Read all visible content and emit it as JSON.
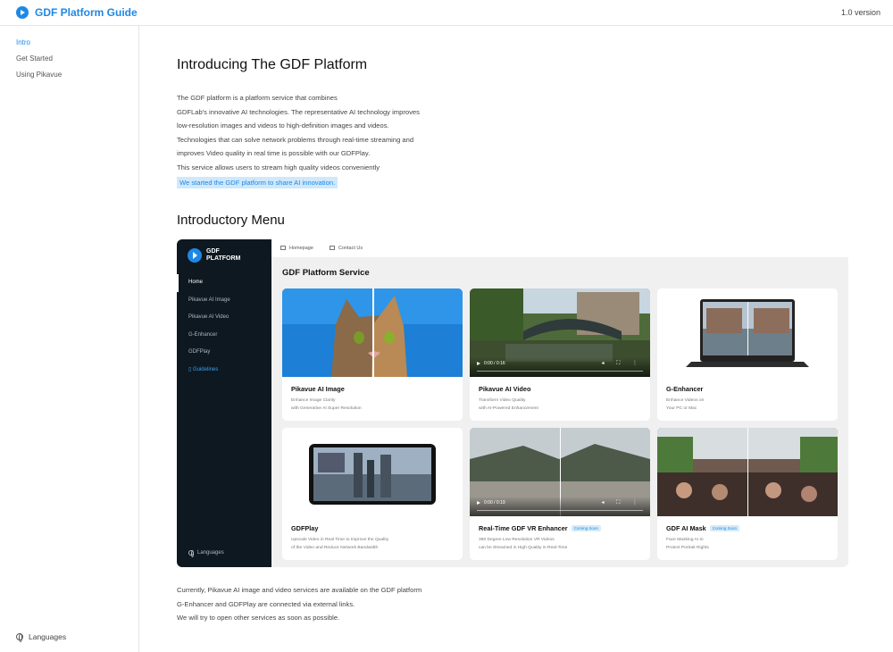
{
  "header": {
    "brand": "GDF Platform Guide",
    "version": "1.0 version"
  },
  "sidebar": {
    "items": [
      {
        "label": "Intro",
        "active": true
      },
      {
        "label": "Get Started"
      },
      {
        "label": "Using Pikavue"
      }
    ],
    "languages": "Languages"
  },
  "main": {
    "title": "Introducing The GDF Platform",
    "intro_lines": [
      "The GDF platform is a platform service that combines",
      "GDFLab's innovative AI technologies. The representative AI technology improves",
      "low-resolution images and videos to high-definition images and videos.",
      "Technologies that can solve network problems through real-time streaming and",
      "improves Video quality in real time is possible with our GDFPlay.",
      "This service allows users to stream high quality videos conveniently"
    ],
    "highlight": "We started the GDF platform to share AI innovation.",
    "menu_title": "Introductory Menu",
    "outro_lines": [
      "Currently, Pikavue AI image and video services are available on the GDF platform",
      "G-Enhancer and GDFPlay are connected via external links.",
      "We will try to open other services as soon as possible."
    ]
  },
  "app": {
    "logo_line1": "GDF",
    "logo_line2": "PLATFORM",
    "nav": [
      "Home",
      "Pikavue AI Image",
      "Pikavue AI Video",
      "G-Enhancer",
      "GDFPlay",
      "Guidelines"
    ],
    "languages": "Languages",
    "top_links": [
      "Homepage",
      "Contact Us"
    ],
    "section_title": "GDF Platform Service",
    "coming_soon": "Coming Soon",
    "cards": [
      {
        "title": "Pikavue AI Image",
        "desc1": "Enhance Image Clarity",
        "desc2": "with Generative AI Super Resolution"
      },
      {
        "title": "Pikavue AI Video",
        "desc1": "Transform Video Quality",
        "desc2": "with AI-Powered Enhancement",
        "time": "0:00 / 0:16"
      },
      {
        "title": "G-Enhancer",
        "desc1": "Enhance Videos on",
        "desc2": "Your PC or Mac"
      },
      {
        "title": "GDFPlay",
        "desc1": "Upscale Video in Real Time to Improve the Quality",
        "desc2": "of the Video and Reduce Network Bandwidth"
      },
      {
        "title": "Real-Time GDF VR Enhancer",
        "desc1": "360 Degree Low Resolution VR Videos",
        "desc2": "can be Streamed in High Quality in Real-Time",
        "time": "0:00 / 0:19"
      },
      {
        "title": "GDF AI Mask",
        "desc1": "Face Masking AI to",
        "desc2": "Protect Portrait Rights"
      }
    ]
  },
  "colors": {
    "accent": "#1e88e5",
    "app_sidebar": "#0e1820",
    "highlight_bg": "#cfe8fb"
  }
}
